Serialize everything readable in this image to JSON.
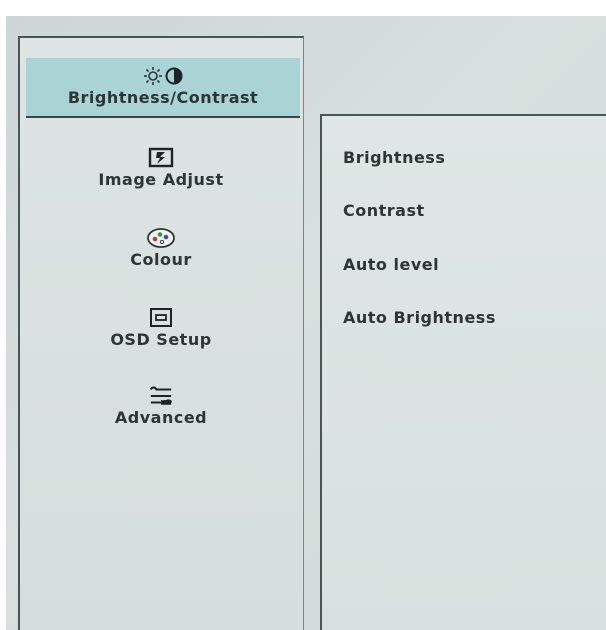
{
  "menu": {
    "items": [
      {
        "label": "Brightness/Contrast",
        "icon": "brightness-contrast-icon",
        "selected": true
      },
      {
        "label": "Image Adjust",
        "icon": "image-adjust-icon",
        "selected": false
      },
      {
        "label": "Colour",
        "icon": "palette-icon",
        "selected": false
      },
      {
        "label": "OSD Setup",
        "icon": "osd-setup-icon",
        "selected": false
      },
      {
        "label": "Advanced",
        "icon": "advanced-settings-icon",
        "selected": false
      }
    ]
  },
  "submenu": {
    "items": [
      {
        "label": "Brightness"
      },
      {
        "label": "Contrast"
      },
      {
        "label": "Auto level"
      },
      {
        "label": "Auto Brightness"
      }
    ]
  },
  "colors": {
    "panel_background": "#d8e0df",
    "selected_background": "#a9d3d4",
    "text": "#2f3535",
    "border": "#4a5454"
  }
}
